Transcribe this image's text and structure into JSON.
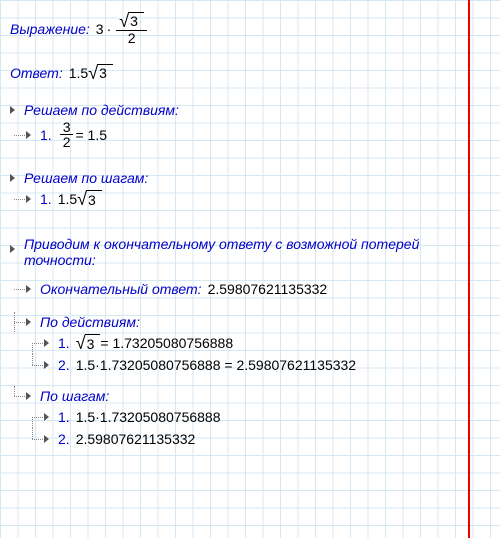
{
  "expression": {
    "label": "Выражение:",
    "coef": "3",
    "mult": "·",
    "num": "3",
    "den": "2"
  },
  "answer": {
    "label": "Ответ:",
    "coef": "1.5",
    "rad": "3"
  },
  "byActions": {
    "header": "Решаем по действиям:",
    "items": [
      {
        "n": "1.",
        "num": "3",
        "den": "2",
        "eq": " = 1.5"
      }
    ]
  },
  "bySteps": {
    "header": "Решаем по шагам:",
    "items": [
      {
        "n": "1.",
        "coef": "1.5",
        "rad": "3"
      }
    ]
  },
  "final": {
    "header": "Приводим к окончательному ответу с возможной потерей точности:",
    "finalLabel": "Окончательный ответ:",
    "finalValue": "2.59807621135332",
    "byActions": {
      "header": "По действиям:",
      "items": [
        {
          "n": "1.",
          "rad": "3",
          "eq": " = 1.73205080756888"
        },
        {
          "n": "2.",
          "text": "1.5·1.73205080756888 = 2.59807621135332"
        }
      ]
    },
    "bySteps": {
      "header": "По шагам:",
      "items": [
        {
          "n": "1.",
          "text": "1.5·1.73205080756888"
        },
        {
          "n": "2.",
          "text": "2.59807621135332"
        }
      ]
    }
  }
}
